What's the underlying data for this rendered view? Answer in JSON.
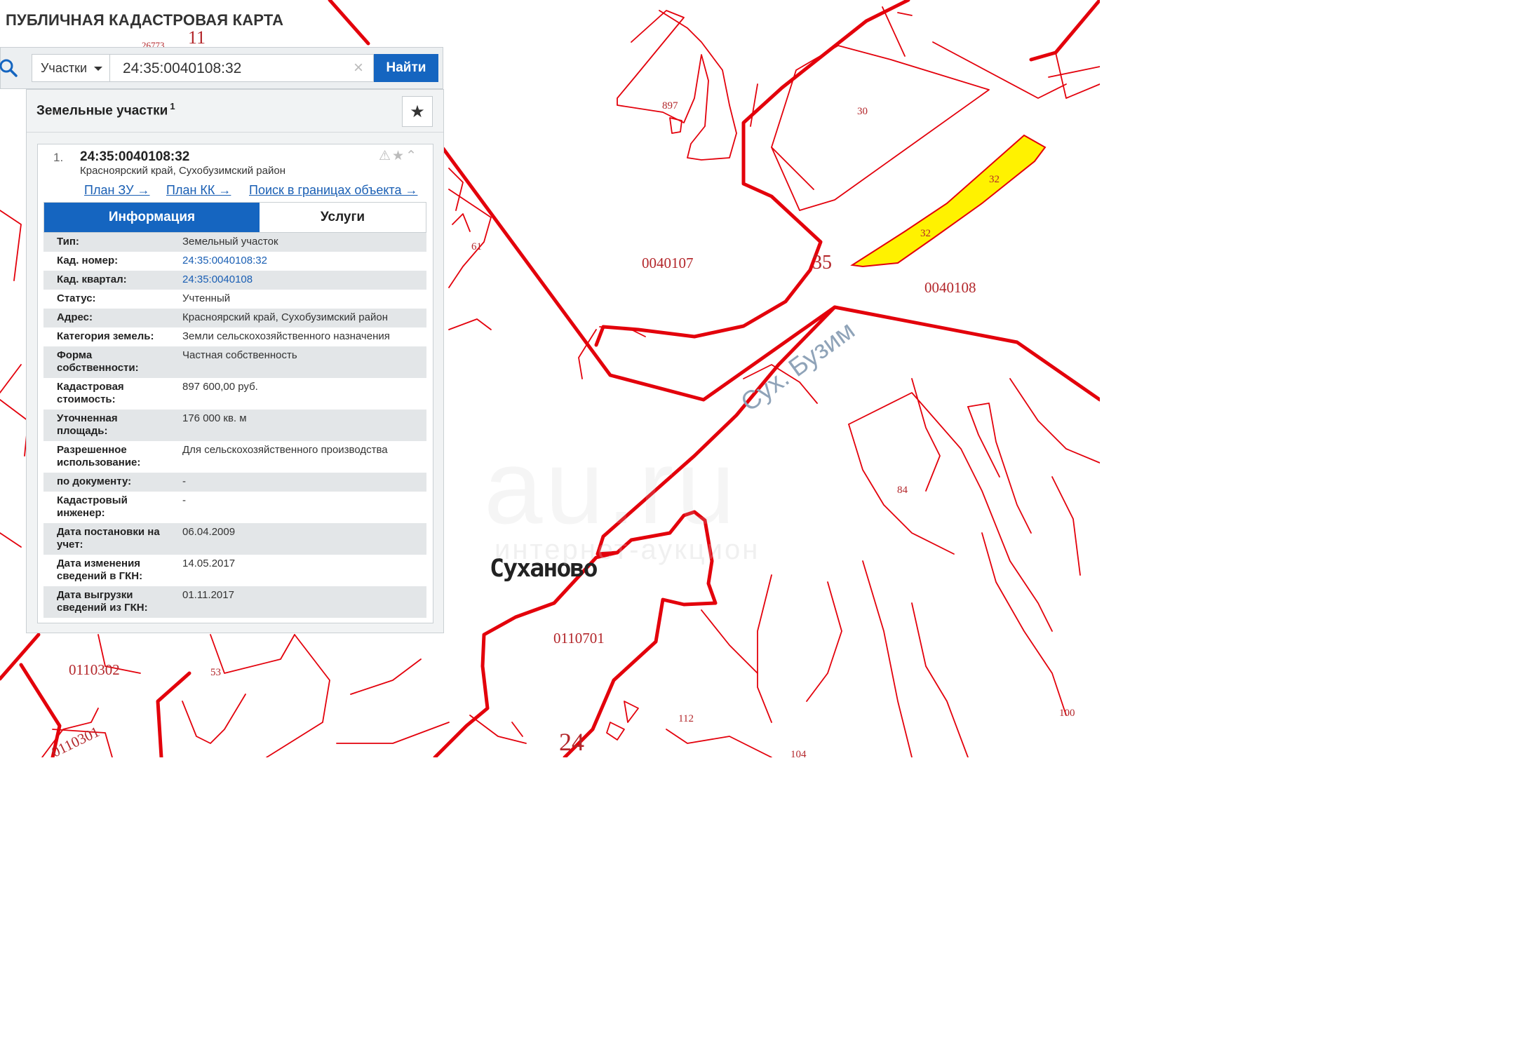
{
  "app": {
    "title": "ПУБЛИЧНАЯ КАДАСТРОВАЯ КАРТА"
  },
  "search": {
    "type": "Участки",
    "query": "24:35:0040108:32",
    "find_label": "Найти"
  },
  "panel": {
    "title": "Земельные участки",
    "count": "1",
    "item": {
      "index": "1.",
      "number": "24:35:0040108:32",
      "address": "Красноярский край, Сухобузимский район",
      "links": [
        "План ЗУ →",
        "План КК →",
        "Поиск в границах объекта →"
      ]
    },
    "tabs": [
      "Информация",
      "Услуги"
    ],
    "info_rows": [
      {
        "key": "Тип:",
        "value": "Земельный участок"
      },
      {
        "key": "Кад. номер:",
        "value": "24:35:0040108:32"
      },
      {
        "key": "Кад. квартал:",
        "value": "24:35:0040108"
      },
      {
        "key": "Статус:",
        "value": "Учтенный"
      },
      {
        "key": "Адрес:",
        "value": "Красноярский край, Сухобузимский район"
      },
      {
        "key": "Категория земель:",
        "value": "Земли сельскохозяйственного назначения"
      },
      {
        "key": "Форма собственности:",
        "value": "Частная собственность"
      },
      {
        "key": "Кадастровая стоимость:",
        "value": "897 600,00 руб."
      },
      {
        "key": "Уточненная площадь:",
        "value": "176 000 кв. м"
      },
      {
        "key": "Разрешенное использование:",
        "value": "Для сельскохозяйственного производства"
      },
      {
        "key": "по документу:",
        "value": "-"
      },
      {
        "key": "Кадастровый инженер:",
        "value": "-"
      },
      {
        "key": "Дата постановки на учет:",
        "value": "06.04.2009"
      },
      {
        "key": "Дата изменения сведений в ГКН:",
        "value": "14.05.2017"
      },
      {
        "key": "Дата выгрузки сведений из ГКН:",
        "value": "01.11.2017"
      }
    ]
  },
  "map": {
    "labels": {
      "q11": "11",
      "q26773": "26773",
      "p897": "897",
      "p30": "30",
      "p32a": "32",
      "p32b": "32",
      "q0040107": "0040107",
      "q35": "35",
      "q0040108": "0040108",
      "p61": "61",
      "river": "Сух. Бузим",
      "town": "Суханово",
      "q0110701": "0110701",
      "q0110302": "0110302",
      "p53": "53",
      "p84": "84",
      "p112": "112",
      "p100": "100",
      "q24": "24",
      "p104": "104",
      "q0110301": "0110301"
    },
    "colors": {
      "boundary": "#e3000b",
      "highlight": "#fff200",
      "river_label": "#8fa3b8",
      "label": "#b3262a"
    }
  },
  "watermark": {
    "brand": "au.ru",
    "tagline": "интернет-аукцион"
  }
}
